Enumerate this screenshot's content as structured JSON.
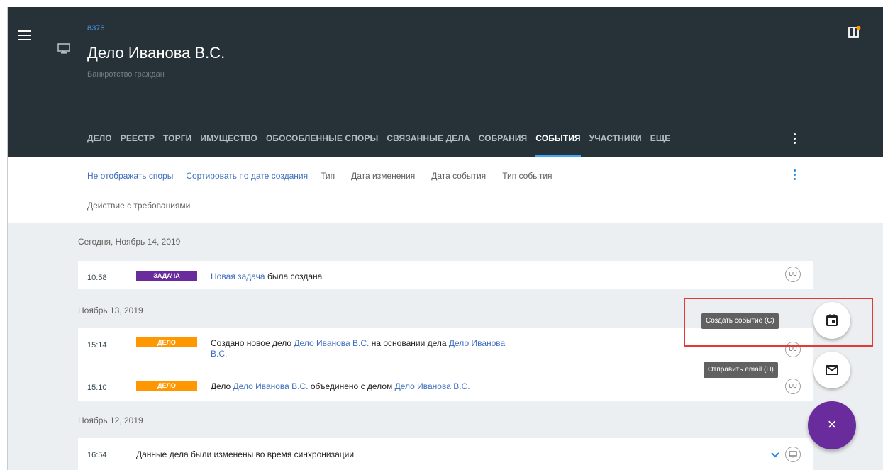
{
  "case": {
    "number": "8376",
    "title": "Дело Иванова В.С.",
    "subtitle": "Банкротство граждан"
  },
  "tabs": [
    {
      "label": "ДЕЛО",
      "active": false
    },
    {
      "label": "РЕЕСТР",
      "active": false
    },
    {
      "label": "ТОРГИ",
      "active": false
    },
    {
      "label": "ИМУЩЕСТВО",
      "active": false
    },
    {
      "label": "ОБОСОБЛЕННЫЕ СПОРЫ",
      "active": false
    },
    {
      "label": "СВЯЗАННЫЕ ДЕЛА",
      "active": false
    },
    {
      "label": "СОБРАНИЯ",
      "active": false
    },
    {
      "label": "СОБЫТИЯ",
      "active": true
    },
    {
      "label": "УЧАСТНИКИ",
      "active": false
    },
    {
      "label": "ЕЩЕ",
      "active": false
    }
  ],
  "filters": {
    "items": [
      {
        "label": "Не отображать споры",
        "link": true
      },
      {
        "label": "Сортировать по дате создания",
        "link": true
      },
      {
        "label": "Тип",
        "link": false
      },
      {
        "label": "Дата изменения",
        "link": false
      },
      {
        "label": "Дата события",
        "link": false
      },
      {
        "label": "Тип события",
        "link": false
      }
    ],
    "action": "Действие с требованиями"
  },
  "feed": {
    "days": [
      "Сегодня, Ноябрь 14, 2019",
      "Ноябрь 13, 2019",
      "Ноябрь 12, 2019"
    ],
    "events": [
      {
        "time": "10:58",
        "badge": "ЗАДАЧА",
        "link1": "Новая задача",
        "text1": " была создана",
        "avatar": "UU"
      },
      {
        "time": "15:14",
        "badge": "ДЕЛО",
        "text0": "Создано новое дело ",
        "link1": "Дело Иванова В.С.",
        "text1": " на основании дела ",
        "link2": "Дело Иванова",
        "link3": "В.С.",
        "avatar": "UU"
      },
      {
        "time": "15:10",
        "badge": "ДЕЛО",
        "text0": "Дело ",
        "link1": "Дело Иванова В.С.",
        "text1": " объединено с делом ",
        "link2": "Дело Иванова В.С.",
        "avatar": "UU"
      },
      {
        "time": "16:54",
        "text0": "Данные дела были изменены во время синхронизации"
      }
    ]
  },
  "fab": {
    "create_event_tooltip": "Создать событие (С)",
    "send_email_tooltip": "Отправить email (П)",
    "close_label": "×"
  },
  "colors": {
    "header_bg": "#263238",
    "accent_blue": "#42a5f5",
    "link": "#3f6fbf",
    "badge_task": "#6a2c9c",
    "badge_case": "#ff9800",
    "fab_main": "#6a2c9c",
    "highlight": "#e53935"
  }
}
